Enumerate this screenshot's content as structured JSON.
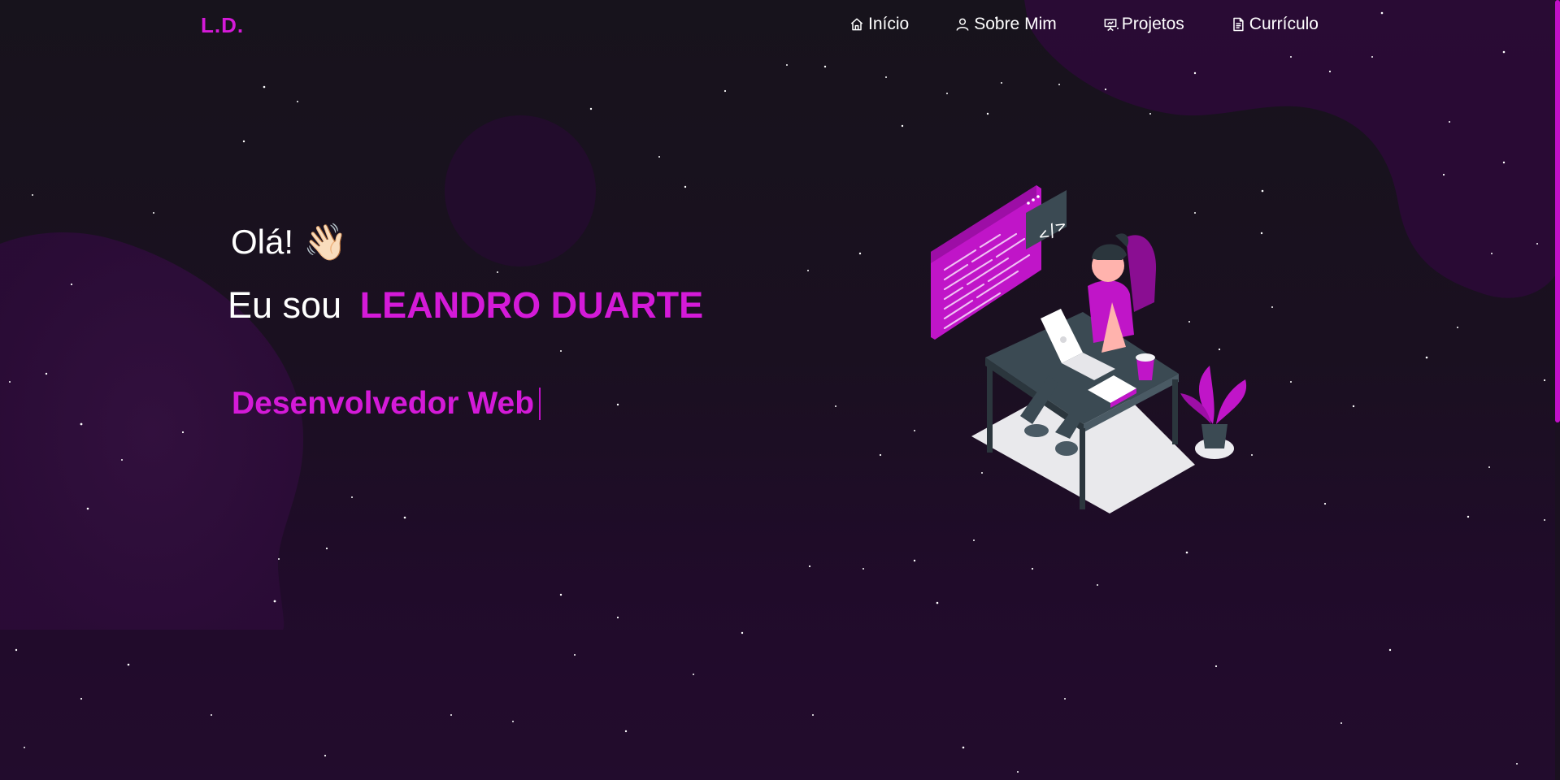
{
  "header": {
    "logo": "L.D.",
    "nav": [
      {
        "label": "Início",
        "icon": "home-icon"
      },
      {
        "label": "Sobre Mim",
        "icon": "user-icon"
      },
      {
        "label": "Projetos",
        "icon": "presentation-icon"
      },
      {
        "label": "Currículo",
        "icon": "document-icon"
      }
    ]
  },
  "hero": {
    "greeting": "Olá!",
    "wave": "👋🏻",
    "intro": "Eu sou",
    "name": "LEANDRO DUARTE",
    "role": "Desenvolvedor Web"
  },
  "colors": {
    "accent": "#d41ad8",
    "background": "#17131c",
    "blob": "#2a0b38"
  }
}
